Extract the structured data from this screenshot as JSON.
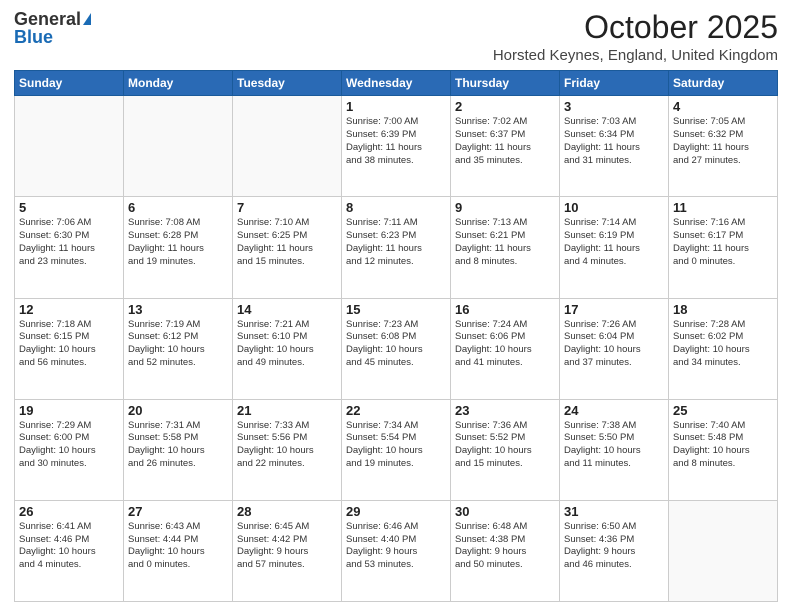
{
  "logo": {
    "general": "General",
    "blue": "Blue"
  },
  "title": "October 2025",
  "location": "Horsted Keynes, England, United Kingdom",
  "weekdays": [
    "Sunday",
    "Monday",
    "Tuesday",
    "Wednesday",
    "Thursday",
    "Friday",
    "Saturday"
  ],
  "weeks": [
    [
      {
        "day": "",
        "info": ""
      },
      {
        "day": "",
        "info": ""
      },
      {
        "day": "",
        "info": ""
      },
      {
        "day": "1",
        "info": "Sunrise: 7:00 AM\nSunset: 6:39 PM\nDaylight: 11 hours\nand 38 minutes."
      },
      {
        "day": "2",
        "info": "Sunrise: 7:02 AM\nSunset: 6:37 PM\nDaylight: 11 hours\nand 35 minutes."
      },
      {
        "day": "3",
        "info": "Sunrise: 7:03 AM\nSunset: 6:34 PM\nDaylight: 11 hours\nand 31 minutes."
      },
      {
        "day": "4",
        "info": "Sunrise: 7:05 AM\nSunset: 6:32 PM\nDaylight: 11 hours\nand 27 minutes."
      }
    ],
    [
      {
        "day": "5",
        "info": "Sunrise: 7:06 AM\nSunset: 6:30 PM\nDaylight: 11 hours\nand 23 minutes."
      },
      {
        "day": "6",
        "info": "Sunrise: 7:08 AM\nSunset: 6:28 PM\nDaylight: 11 hours\nand 19 minutes."
      },
      {
        "day": "7",
        "info": "Sunrise: 7:10 AM\nSunset: 6:25 PM\nDaylight: 11 hours\nand 15 minutes."
      },
      {
        "day": "8",
        "info": "Sunrise: 7:11 AM\nSunset: 6:23 PM\nDaylight: 11 hours\nand 12 minutes."
      },
      {
        "day": "9",
        "info": "Sunrise: 7:13 AM\nSunset: 6:21 PM\nDaylight: 11 hours\nand 8 minutes."
      },
      {
        "day": "10",
        "info": "Sunrise: 7:14 AM\nSunset: 6:19 PM\nDaylight: 11 hours\nand 4 minutes."
      },
      {
        "day": "11",
        "info": "Sunrise: 7:16 AM\nSunset: 6:17 PM\nDaylight: 11 hours\nand 0 minutes."
      }
    ],
    [
      {
        "day": "12",
        "info": "Sunrise: 7:18 AM\nSunset: 6:15 PM\nDaylight: 10 hours\nand 56 minutes."
      },
      {
        "day": "13",
        "info": "Sunrise: 7:19 AM\nSunset: 6:12 PM\nDaylight: 10 hours\nand 52 minutes."
      },
      {
        "day": "14",
        "info": "Sunrise: 7:21 AM\nSunset: 6:10 PM\nDaylight: 10 hours\nand 49 minutes."
      },
      {
        "day": "15",
        "info": "Sunrise: 7:23 AM\nSunset: 6:08 PM\nDaylight: 10 hours\nand 45 minutes."
      },
      {
        "day": "16",
        "info": "Sunrise: 7:24 AM\nSunset: 6:06 PM\nDaylight: 10 hours\nand 41 minutes."
      },
      {
        "day": "17",
        "info": "Sunrise: 7:26 AM\nSunset: 6:04 PM\nDaylight: 10 hours\nand 37 minutes."
      },
      {
        "day": "18",
        "info": "Sunrise: 7:28 AM\nSunset: 6:02 PM\nDaylight: 10 hours\nand 34 minutes."
      }
    ],
    [
      {
        "day": "19",
        "info": "Sunrise: 7:29 AM\nSunset: 6:00 PM\nDaylight: 10 hours\nand 30 minutes."
      },
      {
        "day": "20",
        "info": "Sunrise: 7:31 AM\nSunset: 5:58 PM\nDaylight: 10 hours\nand 26 minutes."
      },
      {
        "day": "21",
        "info": "Sunrise: 7:33 AM\nSunset: 5:56 PM\nDaylight: 10 hours\nand 22 minutes."
      },
      {
        "day": "22",
        "info": "Sunrise: 7:34 AM\nSunset: 5:54 PM\nDaylight: 10 hours\nand 19 minutes."
      },
      {
        "day": "23",
        "info": "Sunrise: 7:36 AM\nSunset: 5:52 PM\nDaylight: 10 hours\nand 15 minutes."
      },
      {
        "day": "24",
        "info": "Sunrise: 7:38 AM\nSunset: 5:50 PM\nDaylight: 10 hours\nand 11 minutes."
      },
      {
        "day": "25",
        "info": "Sunrise: 7:40 AM\nSunset: 5:48 PM\nDaylight: 10 hours\nand 8 minutes."
      }
    ],
    [
      {
        "day": "26",
        "info": "Sunrise: 6:41 AM\nSunset: 4:46 PM\nDaylight: 10 hours\nand 4 minutes."
      },
      {
        "day": "27",
        "info": "Sunrise: 6:43 AM\nSunset: 4:44 PM\nDaylight: 10 hours\nand 0 minutes."
      },
      {
        "day": "28",
        "info": "Sunrise: 6:45 AM\nSunset: 4:42 PM\nDaylight: 9 hours\nand 57 minutes."
      },
      {
        "day": "29",
        "info": "Sunrise: 6:46 AM\nSunset: 4:40 PM\nDaylight: 9 hours\nand 53 minutes."
      },
      {
        "day": "30",
        "info": "Sunrise: 6:48 AM\nSunset: 4:38 PM\nDaylight: 9 hours\nand 50 minutes."
      },
      {
        "day": "31",
        "info": "Sunrise: 6:50 AM\nSunset: 4:36 PM\nDaylight: 9 hours\nand 46 minutes."
      },
      {
        "day": "",
        "info": ""
      }
    ]
  ]
}
